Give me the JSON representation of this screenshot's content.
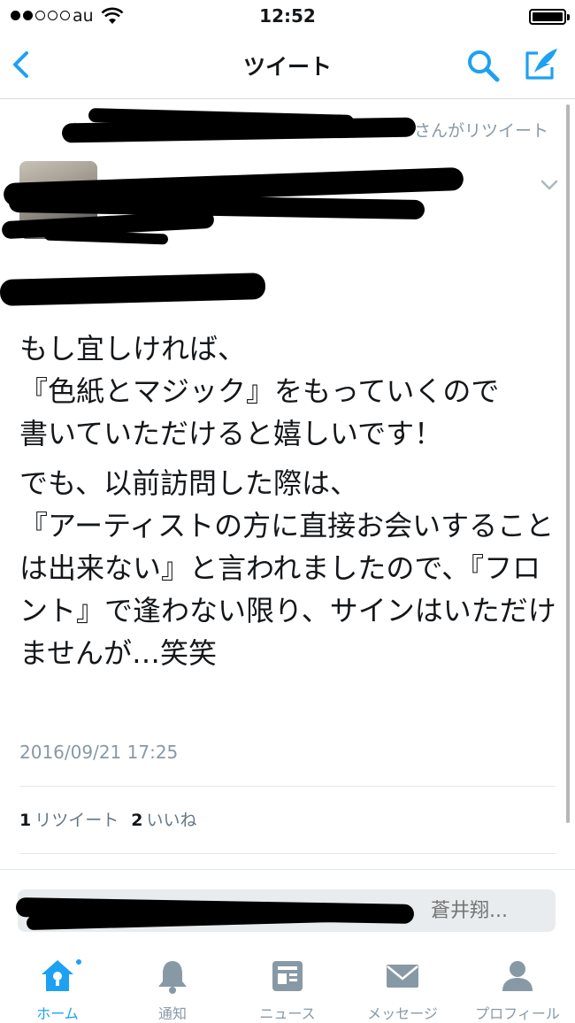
{
  "status_bar": {
    "carrier": "au",
    "time": "12:52",
    "signal_bars_filled": 2,
    "signal_bars_total": 5,
    "battery_level": 1.0
  },
  "nav": {
    "title": "ツイート",
    "back_icon": "chevron-left-icon",
    "search_icon": "search-icon",
    "compose_icon": "compose-tweet-icon"
  },
  "tweet": {
    "retweeted_by": "さんがリツイート",
    "author_name": "",
    "author_handle": "",
    "reply_to": "",
    "paragraphs": [
      "もし宜しければ、\n『色紙とマジック』をもっていくので\n書いていただけると嬉しいです！",
      "でも、以前訪問した際は、\n『アーティストの方に直接お会いすることは出来ない』と言われましたので、『フロント』で逢わない限り、サインはいただけませんが…笑笑"
    ],
    "timestamp": "2016/09/21 17:25",
    "retweets_count": "1",
    "retweets_label": "リツイート",
    "likes_count": "2",
    "likes_label": "いいね"
  },
  "reply": {
    "placeholder": "蒼井翔..."
  },
  "tabs": [
    {
      "label": "ホーム",
      "icon": "home-icon",
      "active": true
    },
    {
      "label": "通知",
      "icon": "bell-icon",
      "active": false
    },
    {
      "label": "ニュース",
      "icon": "news-icon",
      "active": false
    },
    {
      "label": "メッセージ",
      "icon": "envelope-icon",
      "active": false
    },
    {
      "label": "プロフィール",
      "icon": "profile-icon",
      "active": false
    }
  ],
  "colors": {
    "accent": "#1da1f2",
    "secondary_text": "#8899a6",
    "primary_text": "#14171a"
  }
}
